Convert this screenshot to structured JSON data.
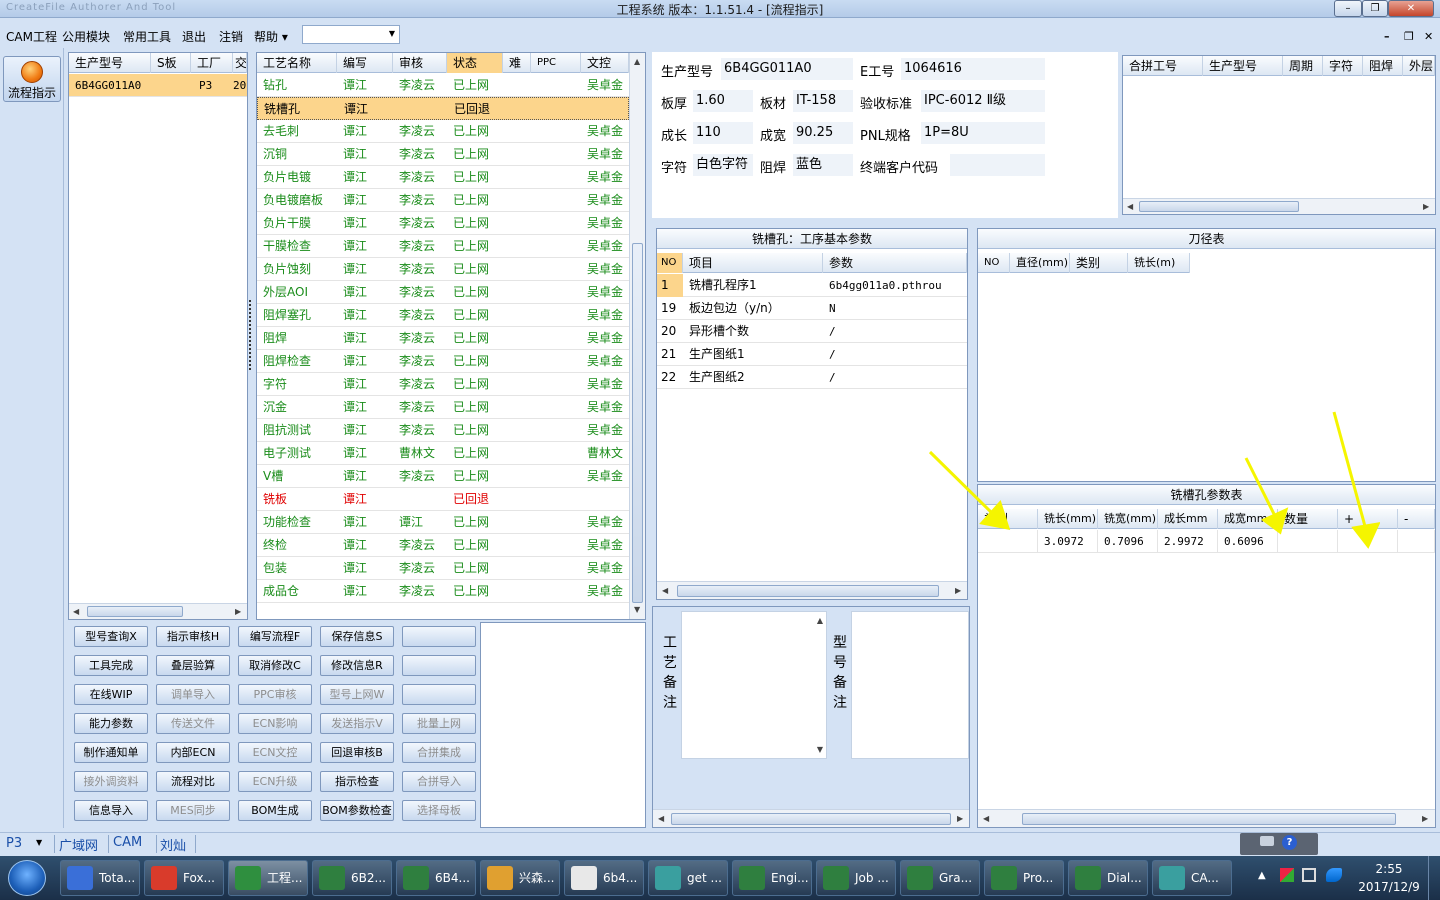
{
  "window": {
    "title": "工程系统    版本：1.1.51.4 - [流程指示]",
    "ghost_title": "CreateFile Authorer And Tool"
  },
  "menu": {
    "items": [
      "CAM工程",
      "公用模块",
      "常用工具",
      "退出",
      "注销",
      "帮助 ▾"
    ]
  },
  "leftbar": {
    "flow_button": "流程指示"
  },
  "model_list": {
    "headers": [
      "生产型号",
      "S板",
      "工厂",
      "交"
    ],
    "rows": [
      [
        "6B4GG011A0",
        "",
        "P3",
        "20"
      ]
    ]
  },
  "process_table": {
    "headers": [
      "工艺名称",
      "编写",
      "审核",
      "状态",
      "难",
      "PPC",
      "文控"
    ],
    "rows": [
      {
        "name": "钻孔",
        "writer": "谭江",
        "reviewer": "李凌云",
        "status": "已上网",
        "ppc": "",
        "doc": "吴卓金",
        "kind": "ok"
      },
      {
        "name": "铣槽孔",
        "writer": "谭江",
        "reviewer": "",
        "status": "已回退",
        "ppc": "",
        "doc": "",
        "kind": "selected"
      },
      {
        "name": "去毛刺",
        "writer": "谭江",
        "reviewer": "李凌云",
        "status": "已上网",
        "ppc": "",
        "doc": "吴卓金",
        "kind": "ok"
      },
      {
        "name": "沉铜",
        "writer": "谭江",
        "reviewer": "李凌云",
        "status": "已上网",
        "ppc": "",
        "doc": "吴卓金",
        "kind": "ok"
      },
      {
        "name": "负片电镀",
        "writer": "谭江",
        "reviewer": "李凌云",
        "status": "已上网",
        "ppc": "",
        "doc": "吴卓金",
        "kind": "ok"
      },
      {
        "name": "负电镀磨板",
        "writer": "谭江",
        "reviewer": "李凌云",
        "status": "已上网",
        "ppc": "",
        "doc": "吴卓金",
        "kind": "ok"
      },
      {
        "name": "负片干膜",
        "writer": "谭江",
        "reviewer": "李凌云",
        "status": "已上网",
        "ppc": "",
        "doc": "吴卓金",
        "kind": "ok"
      },
      {
        "name": "干膜检查",
        "writer": "谭江",
        "reviewer": "李凌云",
        "status": "已上网",
        "ppc": "",
        "doc": "吴卓金",
        "kind": "ok"
      },
      {
        "name": "负片蚀刻",
        "writer": "谭江",
        "reviewer": "李凌云",
        "status": "已上网",
        "ppc": "",
        "doc": "吴卓金",
        "kind": "ok"
      },
      {
        "name": "外层AOI",
        "writer": "谭江",
        "reviewer": "李凌云",
        "status": "已上网",
        "ppc": "",
        "doc": "吴卓金",
        "kind": "ok"
      },
      {
        "name": "阻焊塞孔",
        "writer": "谭江",
        "reviewer": "李凌云",
        "status": "已上网",
        "ppc": "",
        "doc": "吴卓金",
        "kind": "ok"
      },
      {
        "name": "阻焊",
        "writer": "谭江",
        "reviewer": "李凌云",
        "status": "已上网",
        "ppc": "",
        "doc": "吴卓金",
        "kind": "ok"
      },
      {
        "name": "阻焊检查",
        "writer": "谭江",
        "reviewer": "李凌云",
        "status": "已上网",
        "ppc": "",
        "doc": "吴卓金",
        "kind": "ok"
      },
      {
        "name": "字符",
        "writer": "谭江",
        "reviewer": "李凌云",
        "status": "已上网",
        "ppc": "",
        "doc": "吴卓金",
        "kind": "ok"
      },
      {
        "name": "沉金",
        "writer": "谭江",
        "reviewer": "李凌云",
        "status": "已上网",
        "ppc": "",
        "doc": "吴卓金",
        "kind": "ok"
      },
      {
        "name": "阻抗测试",
        "writer": "谭江",
        "reviewer": "李凌云",
        "status": "已上网",
        "ppc": "",
        "doc": "吴卓金",
        "kind": "ok"
      },
      {
        "name": "电子测试",
        "writer": "谭江",
        "reviewer": "曹林文",
        "status": "已上网",
        "ppc": "",
        "doc": "曹林文",
        "kind": "ok"
      },
      {
        "name": "V槽",
        "writer": "谭江",
        "reviewer": "李凌云",
        "status": "已上网",
        "ppc": "",
        "doc": "吴卓金",
        "kind": "ok"
      },
      {
        "name": "铣板",
        "writer": "谭江",
        "reviewer": "",
        "status": "已回退",
        "ppc": "",
        "doc": "",
        "kind": "back"
      },
      {
        "name": "功能检查",
        "writer": "谭江",
        "reviewer": "谭江",
        "status": "已上网",
        "ppc": "",
        "doc": "吴卓金",
        "kind": "ok"
      },
      {
        "name": "终检",
        "writer": "谭江",
        "reviewer": "李凌云",
        "status": "已上网",
        "ppc": "",
        "doc": "吴卓金",
        "kind": "ok"
      },
      {
        "name": "包装",
        "writer": "谭江",
        "reviewer": "李凌云",
        "status": "已上网",
        "ppc": "",
        "doc": "吴卓金",
        "kind": "ok"
      },
      {
        "name": "成品仓",
        "writer": "谭江",
        "reviewer": "李凌云",
        "status": "已上网",
        "ppc": "",
        "doc": "吴卓金",
        "kind": "ok"
      }
    ]
  },
  "buttons": [
    [
      "型号查询X",
      "指示审核H",
      "编写流程F",
      "保存信息S",
      ""
    ],
    [
      "工具完成",
      "叠层验算",
      "取消修改C",
      "修改信息R",
      ""
    ],
    [
      "在线WIP",
      "调单导入",
      "PPC审核",
      "型号上网W",
      ""
    ],
    [
      "能力参数",
      "传送文件",
      "ECN影响",
      "发送指示V",
      "批量上网"
    ],
    [
      "制作通知单",
      "内部ECN",
      "ECN文控",
      "回退审核B",
      "合拼集成"
    ],
    [
      "接外调资料",
      "流程对比",
      "ECN升级",
      "指示检查",
      "合拼导入"
    ],
    [
      "信息导入",
      "MES同步",
      "BOM生成",
      "BOM参数检查",
      "选择母板"
    ]
  ],
  "buttons_disabled": [
    [
      false,
      false,
      false,
      false,
      false
    ],
    [
      false,
      false,
      false,
      false,
      false
    ],
    [
      false,
      true,
      true,
      true,
      false
    ],
    [
      false,
      true,
      true,
      true,
      true
    ],
    [
      false,
      false,
      true,
      false,
      true
    ],
    [
      true,
      false,
      true,
      false,
      true
    ],
    [
      false,
      true,
      false,
      false,
      true
    ]
  ],
  "info": {
    "model_label": "生产型号",
    "model": "6B4GG011A0",
    "eno_label": "E工号",
    "eno": "1064616",
    "thickness_label": "板厚",
    "thickness": "1.60",
    "material_label": "板材",
    "material": "IT-158",
    "standard_label": "验收标准",
    "standard": "IPC-6012 Ⅱ级",
    "length_label": "成长",
    "length": "110",
    "width_label": "成宽",
    "width": "90.25",
    "pnl_label": "PNL规格",
    "pnl": "1P=8U",
    "char_label": "字符",
    "char": "白色字符",
    "mask_label": "阻焊",
    "mask": "蓝色",
    "customer_label": "终端客户代码",
    "customer": ""
  },
  "merge_table": {
    "headers": [
      "合拼工号",
      "生产型号",
      "周期",
      "字符",
      "阻焊",
      "外层"
    ]
  },
  "params": {
    "title": "铣槽孔：工序基本参数",
    "headers": [
      "NO",
      "项目",
      "参数"
    ],
    "rows": [
      [
        "1",
        "铣槽孔程序1",
        "6b4gg011a0.pthrou"
      ],
      [
        "19",
        "板边包边（y/n）",
        "N"
      ],
      [
        "20",
        "异形槽个数",
        "/"
      ],
      [
        "21",
        "生产图纸1",
        "/"
      ],
      [
        "22",
        "生产图纸2",
        "/"
      ]
    ]
  },
  "tool_table": {
    "title": "刀径表",
    "headers": [
      "NO",
      "直径(mm)",
      "类别",
      "铣长(m)"
    ]
  },
  "slot_table": {
    "title": "铣槽孔参数表",
    "headers": [
      "类别",
      "铣长(mm)",
      "铣宽(mm)",
      "成长mm",
      "成宽mm",
      "数量",
      "+",
      "-"
    ],
    "rows": [
      [
        "",
        "3.0972",
        "0.7096",
        "2.9972",
        "0.6096",
        "",
        "",
        ""
      ]
    ]
  },
  "notes": {
    "process_label": "工艺备注",
    "model_label": "型号备注"
  },
  "statusbar": {
    "plant": "P3",
    "net": "广域网",
    "module": "CAM",
    "user": "刘灿"
  },
  "taskbar": {
    "items": [
      "Tota...",
      "Fox...",
      "工程...",
      "6B2...",
      "6B4...",
      "兴森...",
      "6b4...",
      "get ...",
      "Engi...",
      "Job ...",
      "Gra...",
      "Pro...",
      "Dial...",
      "CA..."
    ],
    "time": "2:55",
    "date": "2017/12/9"
  },
  "colors": {
    "ok_green": "#1a8c1a",
    "back_red": "#e00000",
    "selected_row": "#fcd58c",
    "arrow_yellow": "#f5f500"
  }
}
